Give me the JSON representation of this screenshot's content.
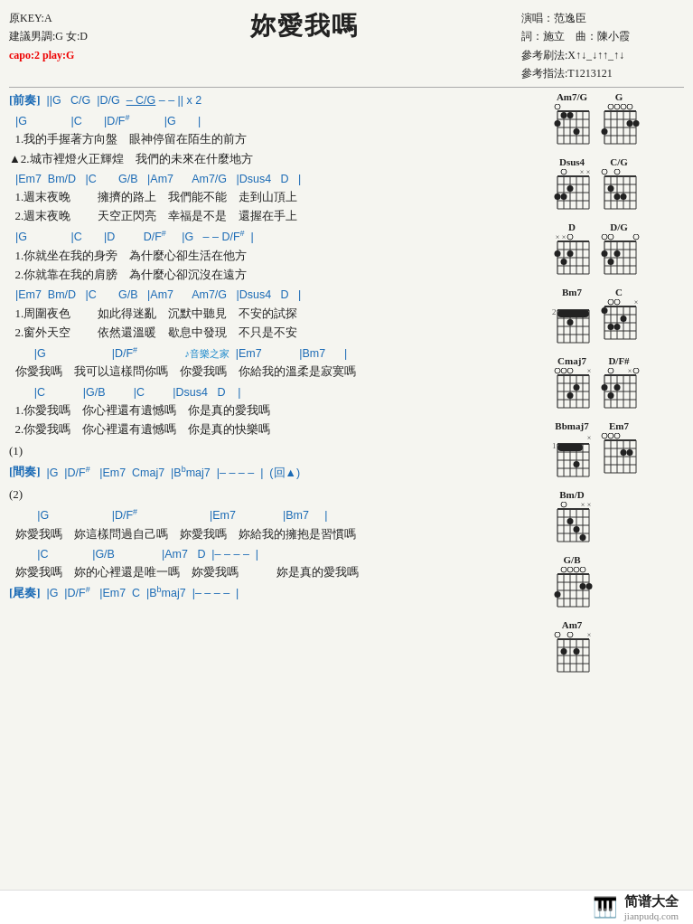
{
  "header": {
    "original_key": "原KEY:A",
    "suggested_key": "建議男調:G 女:D",
    "capo": "capo:2 play:G",
    "title": "妳愛我嗎",
    "performer": "演唱：范逸臣",
    "lyricist": "詞：施立　曲：陳小霞",
    "strumming": "參考刷法:X↑↓_↓↑↑_↑↓",
    "fingering": "參考指法:T1213121"
  },
  "sections": [
    {
      "label": "[前奏]",
      "chord": " ||G   C/G  |D/G  – C/G  – –  || x 2"
    },
    {
      "chord": "  |G              |C       |D/F#                |G       |",
      "lyrics": [
        "  1.我的手握著方向盤    眼神停留在陌生的前方",
        "▲2.城市裡燈火正輝煌    我們的未來在什麼地方"
      ]
    },
    {
      "chord": "  |Em7   Bm/D   |C       G/B   |Am7      Am7/G   |Dsus4   D   |",
      "lyrics": [
        "  1.週末夜晚         擁擠的路上    我們能不能    走到山頂上",
        "  2.週末夜晚         天空正閃亮    幸福是不是    還握在手上"
      ]
    },
    {
      "chord": "  |G              |C       |D         D/F#     |G   – – D/F#  |",
      "lyrics": [
        "  1.你就坐在我的身旁    為什麼心卻生活在他方",
        "  2.你就靠在我的肩膀    為什麼心卻沉沒在遠方"
      ]
    },
    {
      "chord": "  |Em7   Bm/D   |C       G/B   |Am7      Am7/G   |Dsus4   D   |",
      "lyrics": [
        "  1.周圍夜色         如此得迷亂    沉默中聽見    不安的試探",
        "  2.窗外天空         依然還溫暖    歇息中發現    不只是不安"
      ]
    },
    {
      "chord": "        |G                     |D/F#               ♪音樂之家|Em7            |Bm7      |",
      "lyrics": [
        "  你愛我嗎    我可以這樣問你嗎    你愛我嗎    你給我的溫柔是寂寞嗎"
      ]
    },
    {
      "chord": "        |C            |G/B         |C         |Dsus4   D    |",
      "lyrics": [
        "  1.你愛我嗎    你心裡還有遺憾嗎    你是真的愛我嗎",
        "  2.你愛我嗎    你心裡還有遺憾嗎    你是真的快樂嗎"
      ]
    },
    {
      "label": "(1)"
    },
    {
      "label": "[間奏]",
      "chord": " |G   |D/F#   |Em7   Cmaj7   |B♭maj7   |– – – –  |  (回▲)"
    },
    {
      "label": "(2)"
    },
    {
      "chord": "         |G                    |D/F#                       |Em7                |Bm7     |",
      "lyrics": [
        "  妳愛我嗎    妳這樣問過自己嗎    妳愛我嗎    妳給我的擁抱是習慣嗎"
      ]
    },
    {
      "chord": "         |C              |G/B              |Am7   D  |– – – –  |",
      "lyrics": [
        "  妳愛我嗎    妳的心裡還是唯一嗎    妳愛我嗎              妳是真的愛我嗎"
      ]
    },
    {
      "label": "[尾奏]",
      "chord": " |G   |D/F#   |Em7   C   |B♭maj7   |– – – –  |"
    }
  ],
  "chord_diagrams": [
    {
      "row": [
        {
          "name": "Am7/G",
          "fret": "",
          "dots": [
            [
              1,
              2
            ],
            [
              1,
              3
            ],
            [
              2,
              1
            ],
            [
              3,
              4
            ]
          ],
          "open": [
            0,
            5
          ],
          "mute": []
        },
        {
          "name": "G",
          "fret": "",
          "dots": [
            [
              2,
              5
            ],
            [
              2,
              6
            ],
            [
              3,
              1
            ]
          ],
          "open": [
            1,
            2,
            3,
            4
          ],
          "mute": []
        }
      ]
    },
    {
      "row": [
        {
          "name": "Dsus4",
          "fret": "",
          "dots": [
            [
              2,
              3
            ],
            [
              3,
              1
            ],
            [
              3,
              2
            ]
          ],
          "open": [
            1
          ],
          "mute": [
            5,
            6
          ]
        },
        {
          "name": "C/G",
          "fret": "",
          "dots": [
            [
              2,
              4
            ],
            [
              3,
              5
            ],
            [
              3,
              2
            ]
          ],
          "open": [
            1,
            3
          ],
          "mute": []
        }
      ]
    },
    {
      "row": [
        {
          "name": "D",
          "fret": "",
          "dots": [
            [
              2,
              1
            ],
            [
              2,
              3
            ],
            [
              3,
              2
            ]
          ],
          "open": [
            2
          ],
          "mute": [
            5,
            6
          ]
        },
        {
          "name": "D/G",
          "fret": "",
          "dots": [
            [
              2,
              1
            ],
            [
              2,
              3
            ],
            [
              3,
              2
            ]
          ],
          "open": [
            1,
            2,
            6
          ],
          "mute": []
        }
      ]
    },
    {
      "row": [
        {
          "name": "Bm7",
          "fret": "2",
          "dots": [
            [
              1,
              1
            ],
            [
              1,
              2
            ],
            [
              1,
              3
            ],
            [
              1,
              4
            ],
            [
              1,
              5
            ],
            [
              2,
              3
            ]
          ],
          "open": [],
          "mute": []
        },
        {
          "name": "C",
          "fret": "",
          "dots": [
            [
              1,
              1
            ],
            [
              2,
              4
            ],
            [
              3,
              5
            ],
            [
              3,
              2
            ]
          ],
          "open": [
            2,
            3
          ],
          "mute": [
            6
          ]
        }
      ]
    },
    {
      "row": [
        {
          "name": "Cmaj7",
          "fret": "",
          "dots": [
            [
              2,
              4
            ],
            [
              3,
              5
            ]
          ],
          "open": [
            1,
            2,
            3
          ],
          "mute": [
            6
          ]
        },
        {
          "name": "D/F#",
          "fret": "",
          "dots": [
            [
              2,
              1
            ],
            [
              2,
              3
            ],
            [
              3,
              2
            ]
          ],
          "open": [
            2,
            6
          ],
          "mute": [
            5
          ]
        }
      ]
    },
    {
      "row": [
        {
          "name": "Bbmaj7",
          "fret": "",
          "dots": [
            [
              1,
              1
            ],
            [
              1,
              2
            ],
            [
              1,
              3
            ],
            [
              1,
              4
            ],
            [
              1,
              5
            ],
            [
              3,
              4
            ]
          ],
          "open": [],
          "mute": [
            6
          ]
        },
        {
          "name": "Em7",
          "fret": "",
          "dots": [
            [
              2,
              4
            ],
            [
              2,
              5
            ]
          ],
          "open": [
            1,
            2,
            3
          ],
          "mute": []
        }
      ]
    },
    {
      "row": [
        {
          "name": "Bm/D",
          "fret": "",
          "dots": [
            [
              2,
              2
            ],
            [
              3,
              3
            ],
            [
              4,
              4
            ]
          ],
          "open": [
            1
          ],
          "mute": [
            5,
            6
          ]
        }
      ]
    },
    {
      "row": [
        {
          "name": "G/B",
          "fret": "",
          "dots": [
            [
              2,
              5
            ],
            [
              2,
              6
            ],
            [
              3,
              1
            ]
          ],
          "open": [
            1,
            2,
            3,
            4
          ],
          "mute": []
        }
      ]
    },
    {
      "row": [
        {
          "name": "Am7",
          "fret": "",
          "dots": [
            [
              2,
              2
            ],
            [
              2,
              4
            ]
          ],
          "open": [
            1,
            3
          ],
          "mute": [
            6
          ]
        }
      ]
    }
  ],
  "watermark": "♪音樂之家",
  "footer": {
    "logo": "🎹",
    "name": "简谱大全",
    "url": "jianpudq.com"
  }
}
